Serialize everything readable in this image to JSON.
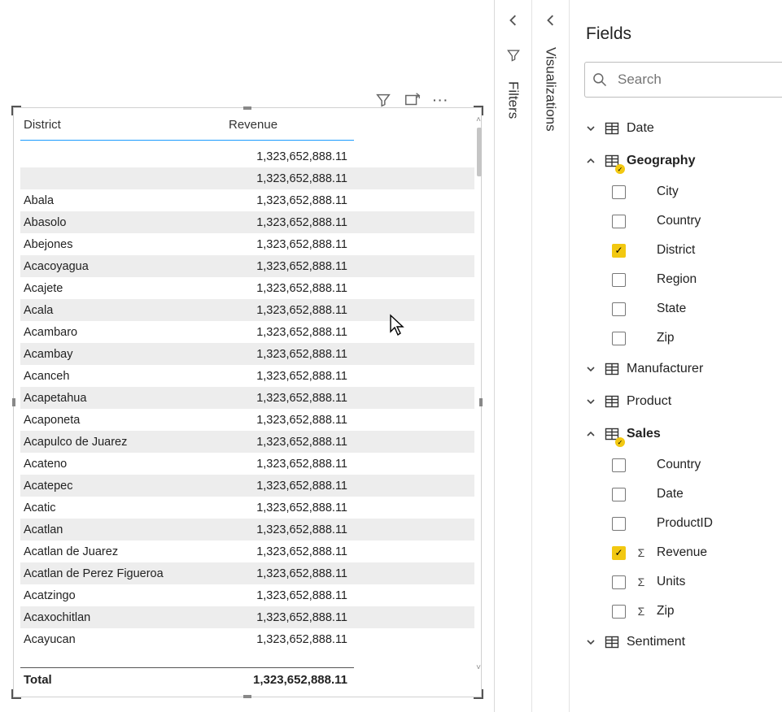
{
  "fields_pane": {
    "title": "Fields",
    "search_placeholder": "Search",
    "tables": [
      {
        "name": "Date",
        "expanded": false,
        "has_used_field": false,
        "fields": []
      },
      {
        "name": "Geography",
        "expanded": true,
        "has_used_field": true,
        "fields": [
          {
            "label": "City",
            "checked": false,
            "agg": false
          },
          {
            "label": "Country",
            "checked": false,
            "agg": false
          },
          {
            "label": "District",
            "checked": true,
            "agg": false
          },
          {
            "label": "Region",
            "checked": false,
            "agg": false
          },
          {
            "label": "State",
            "checked": false,
            "agg": false
          },
          {
            "label": "Zip",
            "checked": false,
            "agg": false
          }
        ]
      },
      {
        "name": "Manufacturer",
        "expanded": false,
        "has_used_field": false,
        "fields": []
      },
      {
        "name": "Product",
        "expanded": false,
        "has_used_field": false,
        "fields": []
      },
      {
        "name": "Sales",
        "expanded": true,
        "has_used_field": true,
        "fields": [
          {
            "label": "Country",
            "checked": false,
            "agg": false
          },
          {
            "label": "Date",
            "checked": false,
            "agg": false
          },
          {
            "label": "ProductID",
            "checked": false,
            "agg": false
          },
          {
            "label": "Revenue",
            "checked": true,
            "agg": true
          },
          {
            "label": "Units",
            "checked": false,
            "agg": true
          },
          {
            "label": "Zip",
            "checked": false,
            "agg": true
          }
        ]
      },
      {
        "name": "Sentiment",
        "expanded": false,
        "has_used_field": false,
        "fields": []
      }
    ]
  },
  "collapsed_panes": {
    "filters_label": "Filters",
    "visualizations_label": "Visualizations"
  },
  "table_visual": {
    "columns": [
      "District",
      "Revenue"
    ],
    "rows": [
      {
        "district": "",
        "revenue": "1,323,652,888.11"
      },
      {
        "district": "",
        "revenue": "1,323,652,888.11"
      },
      {
        "district": "Abala",
        "revenue": "1,323,652,888.11"
      },
      {
        "district": "Abasolo",
        "revenue": "1,323,652,888.11"
      },
      {
        "district": "Abejones",
        "revenue": "1,323,652,888.11"
      },
      {
        "district": "Acacoyagua",
        "revenue": "1,323,652,888.11"
      },
      {
        "district": "Acajete",
        "revenue": "1,323,652,888.11"
      },
      {
        "district": "Acala",
        "revenue": "1,323,652,888.11"
      },
      {
        "district": "Acambaro",
        "revenue": "1,323,652,888.11"
      },
      {
        "district": "Acambay",
        "revenue": "1,323,652,888.11"
      },
      {
        "district": "Acanceh",
        "revenue": "1,323,652,888.11"
      },
      {
        "district": "Acapetahua",
        "revenue": "1,323,652,888.11"
      },
      {
        "district": "Acaponeta",
        "revenue": "1,323,652,888.11"
      },
      {
        "district": "Acapulco de Juarez",
        "revenue": "1,323,652,888.11"
      },
      {
        "district": "Acateno",
        "revenue": "1,323,652,888.11"
      },
      {
        "district": "Acatepec",
        "revenue": "1,323,652,888.11"
      },
      {
        "district": "Acatic",
        "revenue": "1,323,652,888.11"
      },
      {
        "district": "Acatlan",
        "revenue": "1,323,652,888.11"
      },
      {
        "district": "Acatlan de Juarez",
        "revenue": "1,323,652,888.11"
      },
      {
        "district": "Acatlan de Perez Figueroa",
        "revenue": "1,323,652,888.11"
      },
      {
        "district": "Acatzingo",
        "revenue": "1,323,652,888.11"
      },
      {
        "district": "Acaxochitlan",
        "revenue": "1,323,652,888.11"
      },
      {
        "district": "Acayucan",
        "revenue": "1,323,652,888.11"
      }
    ],
    "total_label": "Total",
    "total_value": "1,323,652,888.11"
  }
}
